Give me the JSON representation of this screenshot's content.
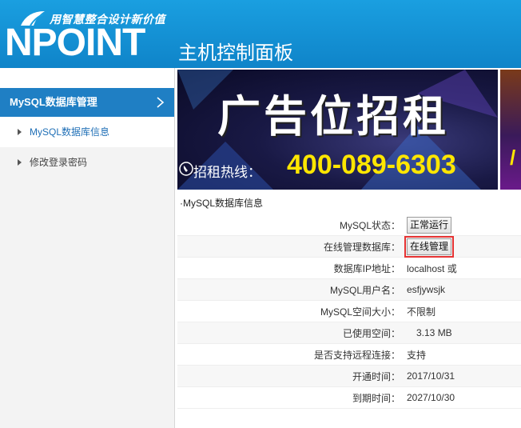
{
  "header": {
    "slogan": "用智慧整合设计新价值",
    "brand": "NPOINT",
    "panel_title": "主机控制面板",
    "bg_color": "#1a9fe0"
  },
  "sidebar": {
    "section_title": "MySQL数据库管理",
    "section_color": "#1f7fc4",
    "items": [
      {
        "label": "MySQL数据库信息",
        "active": true
      },
      {
        "label": "修改登录密码",
        "active": false
      }
    ]
  },
  "banner": {
    "ad_title": "广告位招租",
    "hotline_label": "招租热线：",
    "hotline_number": "400-089-6303",
    "second_glyph": "/"
  },
  "info": {
    "title": "·MySQL数据库信息",
    "rows": [
      {
        "label": "MySQL状态：",
        "value": "正常运行",
        "type": "button"
      },
      {
        "label": "在线管理数据库：",
        "value": "在线管理",
        "type": "button",
        "highlighted": true
      },
      {
        "label": "数据库IP地址：",
        "value": "localhost 或"
      },
      {
        "label": "MySQL用户名：",
        "value": "esfjywsjk"
      },
      {
        "label": "MySQL空间大小：",
        "value": "不限制"
      },
      {
        "label": "已使用空间：",
        "value": "3.13 MB"
      },
      {
        "label": "是否支持远程连接：",
        "value": "支持"
      },
      {
        "label": "开通时间：",
        "value": "2017/10/31"
      },
      {
        "label": "到期时间：",
        "value": "2027/10/30"
      }
    ]
  }
}
